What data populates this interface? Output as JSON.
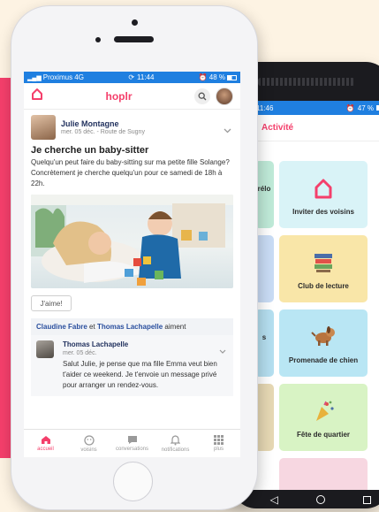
{
  "colors": {
    "brand": "#f43f6b",
    "status_blue": "#1f7fe0",
    "name_blue": "#2a4f9e",
    "background": "#fdf3e3"
  },
  "android": {
    "status": {
      "time": "11:46",
      "battery": "47 %"
    },
    "title": "Activité",
    "tiles": [
      {
        "label": "Inviter des voisins",
        "icon": "house-outline-icon"
      },
      {
        "label": "Club de lecture",
        "icon": "books-icon"
      },
      {
        "label": "Promenade de chien",
        "icon": "dog-icon"
      },
      {
        "label": "Fête de quartier",
        "icon": "party-popper-icon"
      }
    ],
    "partial_tiles": [
      "rélo",
      "s"
    ]
  },
  "iphone": {
    "status": {
      "carrier": "Proximus 4G",
      "time": "11:44",
      "battery": "48 %"
    },
    "app": {
      "brand": "hoplr",
      "logo_icon": "house-outline-icon"
    },
    "post": {
      "author": "Julie Montagne",
      "meta": "mer. 05 déc. - Route de Sugny",
      "title": "Je cherche un baby-sitter",
      "body": "Quelqu'un peut faire du baby-sitting sur ma petite fille Solange? Concrètement je cherche quelqu'un pour ce samedi de 18h à 22h.",
      "like_label": "J'aime!",
      "likes": {
        "name1": "Claudine Fabre",
        "connector": "et",
        "name2": "Thomas Lachapelle",
        "suffix": "aiment"
      }
    },
    "comment": {
      "author": "Thomas Lachapelle",
      "meta": "mer. 05 déc.",
      "text": "Salut Julie, je pense que ma fille Emma veut bien t'aider ce weekend. Je t'envoie un message privé pour arranger un rendez-vous."
    },
    "tabs": [
      {
        "label": "accueil",
        "icon": "home-icon",
        "active": true
      },
      {
        "label": "voisins",
        "icon": "neighbor-face-icon",
        "active": false
      },
      {
        "label": "conversations",
        "icon": "chat-icon",
        "active": false
      },
      {
        "label": "notifications",
        "icon": "bell-icon",
        "active": false
      },
      {
        "label": "plus",
        "icon": "grid-icon",
        "active": false
      }
    ]
  }
}
